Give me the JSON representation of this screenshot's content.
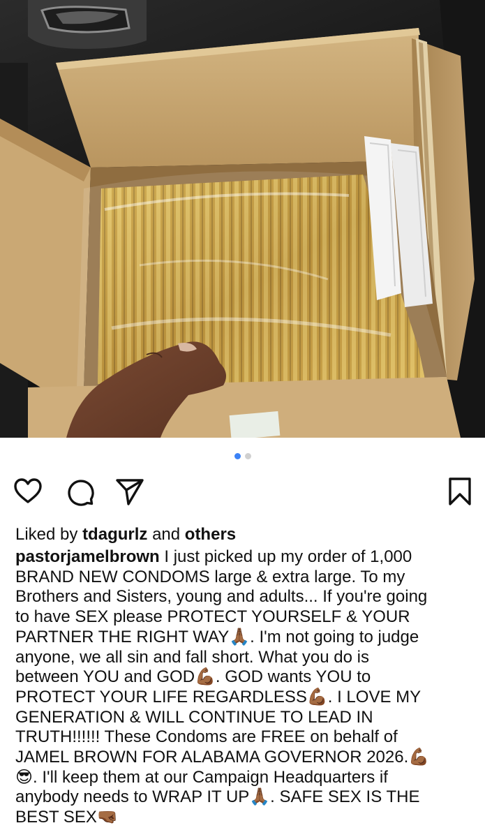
{
  "post": {
    "carousel": {
      "total": 2,
      "active_index": 0
    },
    "actions": {
      "like_icon": "heart-outline-icon",
      "comment_icon": "comment-bubble-icon",
      "share_icon": "paper-plane-icon",
      "save_icon": "bookmark-outline-icon"
    },
    "likes": {
      "prefix": "Liked by",
      "user": "tdagurlz",
      "middle": "and",
      "others": "others"
    },
    "caption": {
      "username": "pastorjamelbrown",
      "text": " I just picked up my order of 1,000\nBRAND NEW CONDOMS large & extra large. To my\nBrothers and Sisters, young and adults... If you're going\nto have SEX please PROTECT YOURSELF & YOUR\nPARTNER THE RIGHT WAY🙏🏾. I'm not going to judge\nanyone, we all sin and fall short. What you do is\nbetween YOU and GOD💪🏾. GOD wants YOU to\nPROTECT YOUR LIFE REGARDLESS💪🏾. I LOVE MY\nGENERATION & WILL CONTINUE TO LEAD IN\nTRUTH!!!!!! These Condoms are FREE on behalf of\nJAMEL BROWN FOR ALABAMA GOVERNOR 2026.💪🏾\n😎. I'll keep them at our Campaign Headquarters if\nanybody needs to WRAP IT UP🙏🏾. SAFE SEX IS THE\nBEST SEX🤜🏾"
    }
  },
  "colors": {
    "accent_dot": "#3b82f6",
    "inactive_dot": "#d0d0d0",
    "cardboard": "#c9a877",
    "gold_packets": "#c99a2e"
  }
}
